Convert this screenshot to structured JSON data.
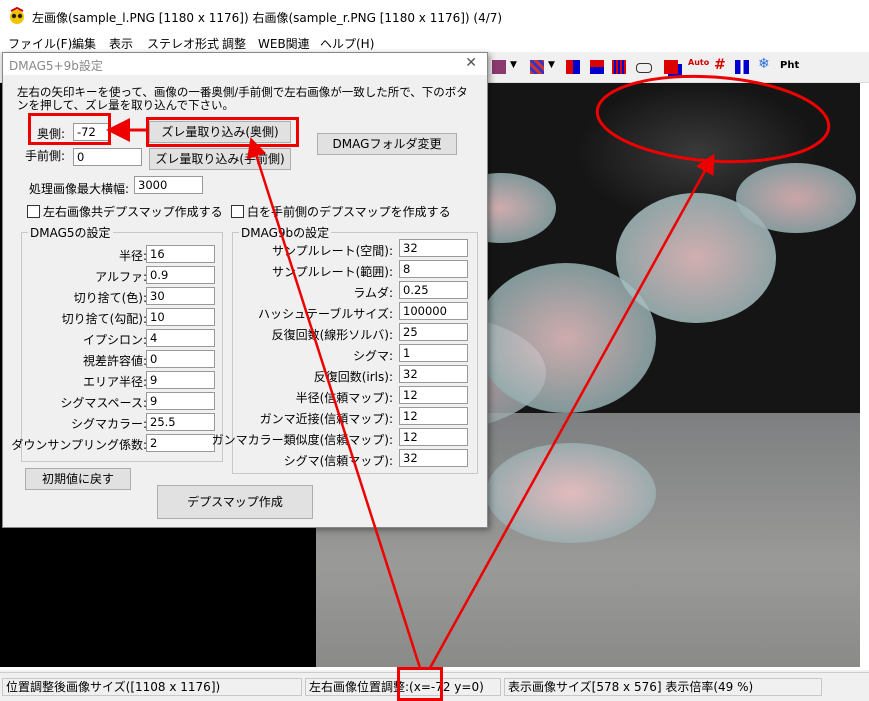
{
  "window": {
    "title": "左画像(sample_l.PNG [1180 x 1176]) 右画像(sample_r.PNG [1180 x 1176]) (4/7)"
  },
  "menu": [
    "ファイル(F)",
    "編集",
    "表示",
    "ステレオ形式",
    "調整",
    "WEB関連",
    "ヘルプ(H)"
  ],
  "toolbar": {
    "pht_label": "Pht",
    "auto_label": "Auto"
  },
  "dialog": {
    "title": "DMAG5+9b設定",
    "close": "✕",
    "description": "左右の矢印キーを使って、画像の一番奥側/手前側で左右画像が一致した所で、下のボタンを押して、ズレ量を取り込んで下さい。",
    "far_label": "奥側:",
    "far_value": "-72",
    "near_label": "手前側:",
    "near_value": "0",
    "capture_far_button": "ズレ量取り込み(奥側)",
    "capture_near_button": "ズレ量取り込み(手前側)",
    "dmag_folder_button": "DMAGフォルダ変更",
    "max_width_label": "処理画像最大横幅:",
    "max_width_value": "3000",
    "checkbox_both": "左右画像共デプスマップ作成する",
    "checkbox_white": "白を手前側のデプスマップを作成する",
    "dmag5": {
      "title": "DMAG5の設定",
      "fields": [
        {
          "label": "半径:",
          "value": "16"
        },
        {
          "label": "アルファ:",
          "value": "0.9"
        },
        {
          "label": "切り捨て(色):",
          "value": "30"
        },
        {
          "label": "切り捨て(勾配):",
          "value": "10"
        },
        {
          "label": "イプシロン:",
          "value": "4"
        },
        {
          "label": "視差許容値:",
          "value": "0"
        },
        {
          "label": "エリア半径:",
          "value": "9"
        },
        {
          "label": "シグマスペース:",
          "value": "9"
        },
        {
          "label": "シグマカラー:",
          "value": "25.5"
        },
        {
          "label": "ダウンサンプリング係数:",
          "value": "2"
        }
      ]
    },
    "dmag9b": {
      "title": "DMAG9bの設定",
      "fields": [
        {
          "label": "サンプルレート(空間):",
          "value": "32"
        },
        {
          "label": "サンプルレート(範囲):",
          "value": "8"
        },
        {
          "label": "ラムダ:",
          "value": "0.25"
        },
        {
          "label": "ハッシュテーブルサイズ:",
          "value": "100000"
        },
        {
          "label": "反復回数(線形ソルバ):",
          "value": "25"
        },
        {
          "label": "シグマ:",
          "value": "1"
        },
        {
          "label": "反復回数(irls):",
          "value": "32"
        },
        {
          "label": "半径(信頼マップ):",
          "value": "12"
        },
        {
          "label": "ガンマ近接(信頼マップ):",
          "value": "12"
        },
        {
          "label": "ガンマカラー類似度(信頼マップ):",
          "value": "12"
        },
        {
          "label": "シグマ(信頼マップ):",
          "value": "32"
        }
      ]
    },
    "reset_button": "初期値に戻す",
    "create_button": "デプスマップ作成"
  },
  "status": {
    "adjusted_size": "位置調整後画像サイズ([1108 x 1176])",
    "position_adjust": "左右画像位置調整:(x=-72 y=0)",
    "display_size": "表示画像サイズ[578 x 576]  表示倍率(49 %)"
  },
  "colors": {
    "annotation": "#e00000"
  }
}
